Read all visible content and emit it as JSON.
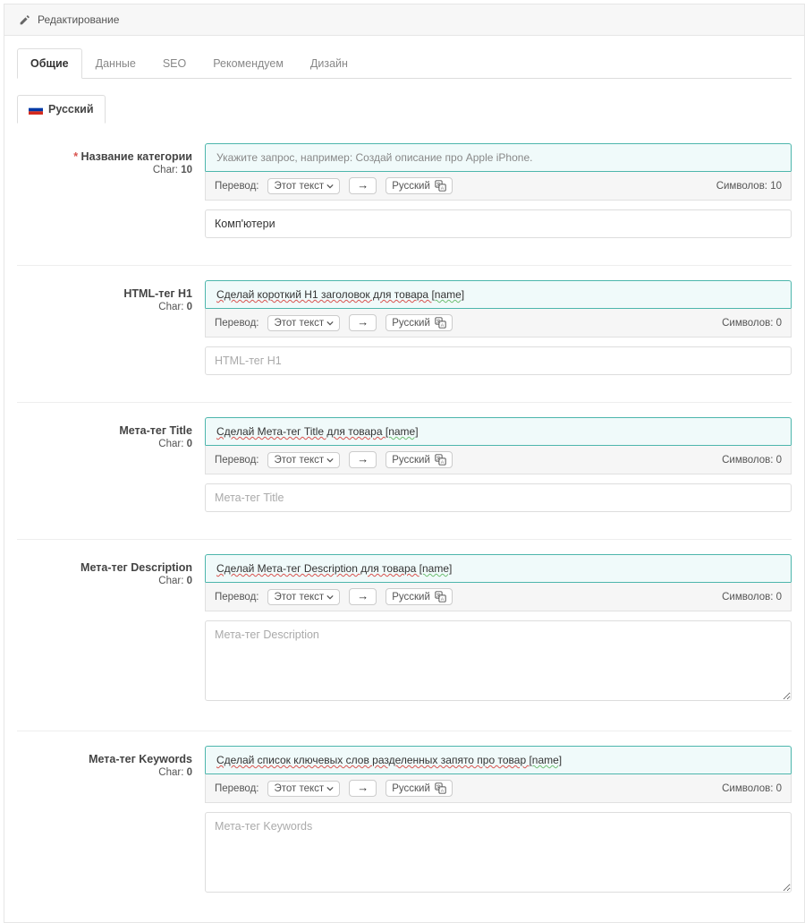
{
  "header": {
    "title": "Редактирование"
  },
  "tabs": [
    {
      "label": "Общие",
      "active": true
    },
    {
      "label": "Данные"
    },
    {
      "label": "SEO"
    },
    {
      "label": "Рекомендуем"
    },
    {
      "label": "Дизайн"
    }
  ],
  "lang": {
    "name": "Русский"
  },
  "common": {
    "translate_label": "Перевод:",
    "this_text": "Этот текст",
    "target_lang": "Русский",
    "char_label": "Char:",
    "symbols_label": "Символов:"
  },
  "fields": [
    {
      "label": "Название категории",
      "required": true,
      "char": "10",
      "prompt_placeholder": "Укажите запрос, например: Создай описание про Apple iPhone.",
      "prompt_value": "",
      "symbols": "10",
      "input_value": "Комп'ютери",
      "input_placeholder": "",
      "textarea": false
    },
    {
      "label": "HTML-тег H1",
      "required": false,
      "char": "0",
      "prompt_placeholder": "",
      "prompt_value": "Сделай короткий H1 заголовок для товара [name]",
      "symbols": "0",
      "input_value": "",
      "input_placeholder": "HTML-тег H1",
      "textarea": false
    },
    {
      "label": "Мета-тег Title",
      "required": false,
      "char": "0",
      "prompt_placeholder": "",
      "prompt_value": "Сделай Мета-тег Title для товара [name]",
      "symbols": "0",
      "input_value": "",
      "input_placeholder": "Мета-тег Title",
      "textarea": false
    },
    {
      "label": "Мета-тег Description",
      "required": false,
      "char": "0",
      "prompt_placeholder": "",
      "prompt_value": "Сделай Мета-тег Description для товара [name]",
      "symbols": "0",
      "input_value": "",
      "input_placeholder": "Мета-тег Description",
      "textarea": true
    },
    {
      "label": "Мета-тег Keywords",
      "required": false,
      "char": "0",
      "prompt_placeholder": "",
      "prompt_value": "Сделай список ключевых слов разделенных запято про  товар [name]",
      "symbols": "0",
      "input_value": "",
      "input_placeholder": "Мета-тег Keywords",
      "textarea": true
    }
  ]
}
